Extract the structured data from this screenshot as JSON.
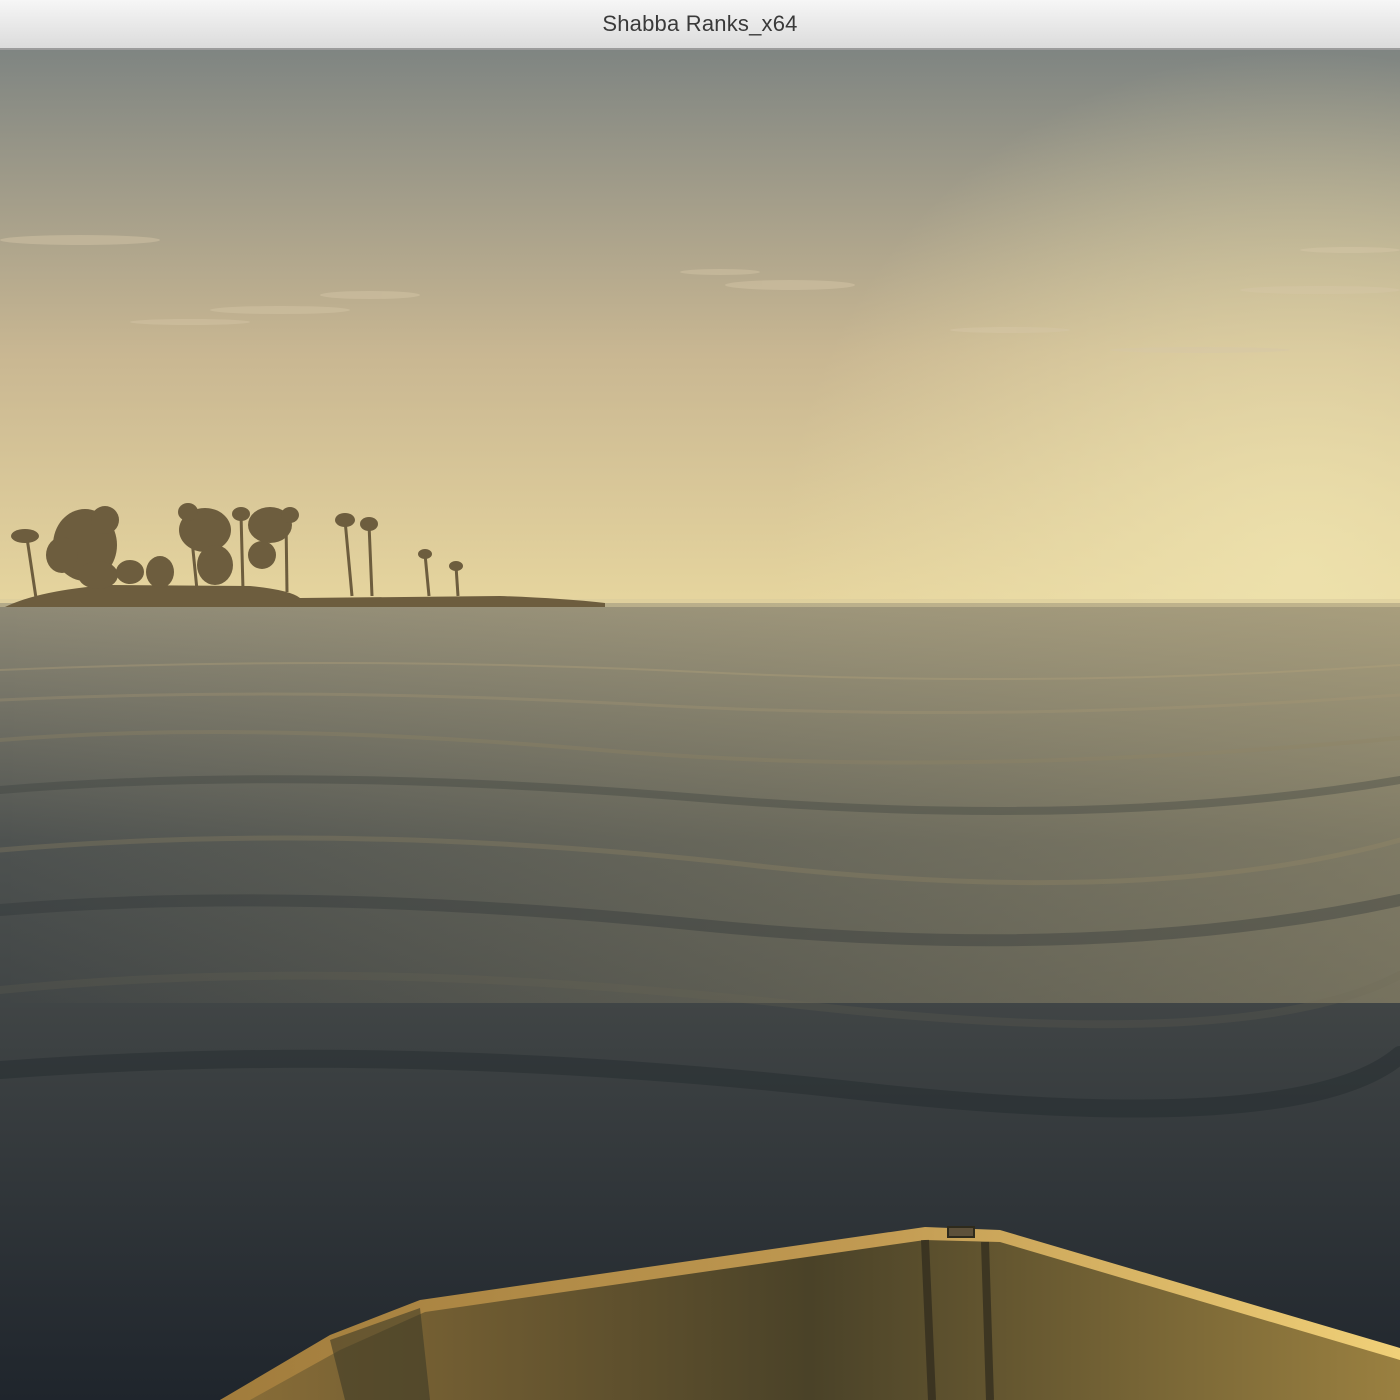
{
  "window": {
    "title": "Shabba Ranks_x64"
  },
  "scene": {
    "type": "first-person-boat-view",
    "time_of_day": "sunset",
    "colors": {
      "sky_top": "#7f8582",
      "sky_mid": "#c9b792",
      "sky_horizon": "#e6d59e",
      "sun_glow": "#efe3ae",
      "sea_far": "#8f8a76",
      "sea_mid": "#4e5250",
      "sea_near": "#1f252c",
      "island": "#6d5d3e",
      "boat": "#6c5a30"
    }
  }
}
